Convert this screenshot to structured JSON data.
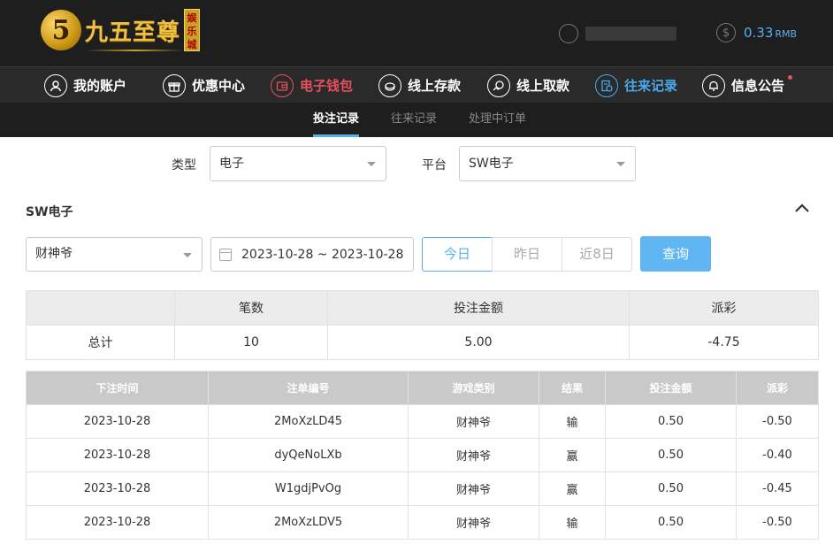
{
  "brand": {
    "name": "九五至尊",
    "badge": "娱乐城"
  },
  "account": {
    "balance": "0.33",
    "currency": "RMB"
  },
  "nav": [
    {
      "label": "我的账户",
      "icon": "user-icon"
    },
    {
      "label": "优惠中心",
      "icon": "gift-icon"
    },
    {
      "label": "电子钱包",
      "icon": "wallet-icon"
    },
    {
      "label": "线上存款",
      "icon": "deposit-icon"
    },
    {
      "label": "线上取款",
      "icon": "withdraw-icon"
    },
    {
      "label": "往来记录",
      "icon": "records-icon"
    },
    {
      "label": "信息公告",
      "icon": "bell-icon"
    }
  ],
  "subnav": [
    "投注记录",
    "往来记录",
    "处理中订单"
  ],
  "filters": {
    "type_label": "类型",
    "type_value": "电子",
    "platform_label": "平台",
    "platform_value": "SW电子"
  },
  "section": {
    "title": "SW电子"
  },
  "query": {
    "game_value": "财神爷",
    "date_range": "2023-10-28 ~ 2023-10-28",
    "quick": [
      "今日",
      "昨日",
      "近8日"
    ],
    "search_label": "查询"
  },
  "summary": {
    "headers": [
      "",
      "笔数",
      "投注金额",
      "派彩"
    ],
    "row": [
      "总计",
      "10",
      "5.00",
      "-4.75"
    ]
  },
  "detail": {
    "headers": [
      "下注时间",
      "注单编号",
      "游戏类别",
      "结果",
      "投注金额",
      "派彩"
    ],
    "rows": [
      [
        "2023-10-28",
        "2MoXzLD45",
        "财神爷",
        "输",
        "0.50",
        "-0.50"
      ],
      [
        "2023-10-28",
        "dyQeNoLXb",
        "财神爷",
        "赢",
        "0.50",
        "-0.40"
      ],
      [
        "2023-10-28",
        "W1gdjPvOg",
        "财神爷",
        "赢",
        "0.50",
        "-0.45"
      ],
      [
        "2023-10-28",
        "2MoXzLDV5",
        "财神爷",
        "输",
        "0.50",
        "-0.50"
      ]
    ]
  },
  "colors": {
    "accent": "#56b0f0",
    "negative": "#e54b4b",
    "active_nav_red": "#e8505b"
  }
}
